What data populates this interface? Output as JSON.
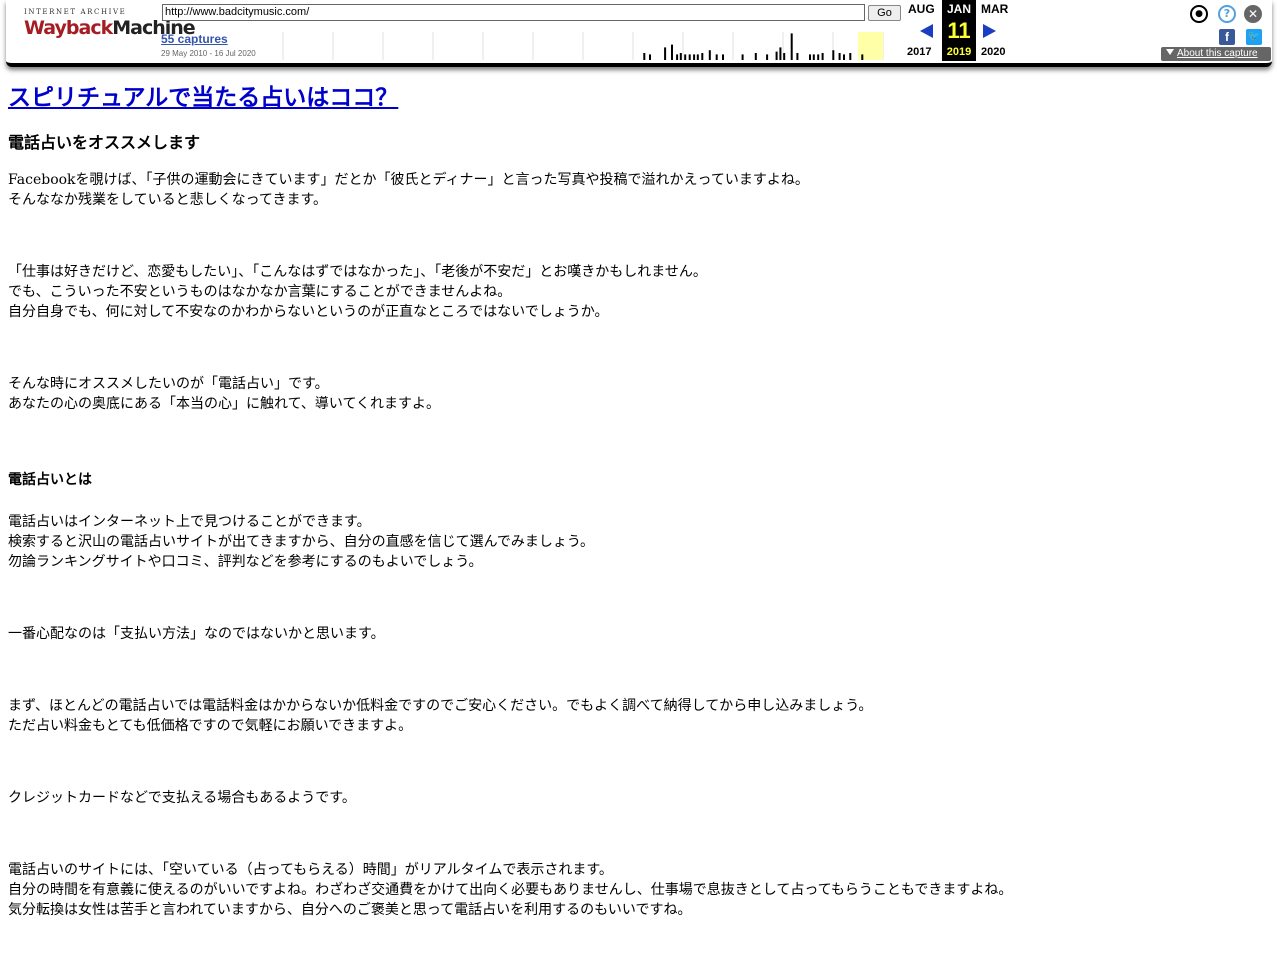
{
  "wayback": {
    "logo_top": "INTERNET ARCHIVE",
    "logo_main_a": "Wayback",
    "logo_main_b": "Machine",
    "url": "http://www.badcitymusic.com/",
    "go_label": "Go",
    "captures_label": "55 captures",
    "capture_range": "29 May 2010 - 16 Jul 2020",
    "prev_month": "AUG",
    "prev_year": "2017",
    "current_month": "JAN",
    "current_day": "11",
    "current_year": "2019",
    "next_month": "MAR",
    "next_year": "2020",
    "about_label": "About this capture",
    "sparkline_bars": [
      {
        "x": 0.583,
        "h": 0.25
      },
      {
        "x": 0.592,
        "h": 0.2
      },
      {
        "x": 0.616,
        "h": 0.45
      },
      {
        "x": 0.627,
        "h": 0.55
      },
      {
        "x": 0.635,
        "h": 0.2
      },
      {
        "x": 0.641,
        "h": 0.25
      },
      {
        "x": 0.648,
        "h": 0.2
      },
      {
        "x": 0.655,
        "h": 0.2
      },
      {
        "x": 0.662,
        "h": 0.2
      },
      {
        "x": 0.668,
        "h": 0.2
      },
      {
        "x": 0.675,
        "h": 0.25
      },
      {
        "x": 0.687,
        "h": 0.35
      },
      {
        "x": 0.698,
        "h": 0.2
      },
      {
        "x": 0.708,
        "h": 0.2
      },
      {
        "x": 0.739,
        "h": 0.2
      },
      {
        "x": 0.76,
        "h": 0.25
      },
      {
        "x": 0.778,
        "h": 0.2
      },
      {
        "x": 0.793,
        "h": 0.3
      },
      {
        "x": 0.799,
        "h": 0.45
      },
      {
        "x": 0.805,
        "h": 0.25
      },
      {
        "x": 0.817,
        "h": 0.95
      },
      {
        "x": 0.826,
        "h": 0.25
      },
      {
        "x": 0.846,
        "h": 0.2
      },
      {
        "x": 0.852,
        "h": 0.2
      },
      {
        "x": 0.859,
        "h": 0.2
      },
      {
        "x": 0.866,
        "h": 0.25
      },
      {
        "x": 0.883,
        "h": 0.35
      },
      {
        "x": 0.893,
        "h": 0.25
      },
      {
        "x": 0.9,
        "h": 0.2
      },
      {
        "x": 0.91,
        "h": 0.25
      },
      {
        "x": 0.929,
        "h": 0.2
      }
    ]
  },
  "page": {
    "title": "スピリチュアルで当たる占いはココ？",
    "subtitle": "電話占いをオススメします",
    "p1": [
      "Facebookを覗けば、「子供の運動会にきています」だとか「彼氏とディナー」と言った写真や投稿で溢れかえっていますよね。",
      "そんななか残業をしていると悲しくなってきます。"
    ],
    "p2": [
      "「仕事は好きだけど、恋愛もしたい」、「こんなはずではなかった」、「老後が不安だ」とお嘆きかもしれません。",
      "でも、こういった不安というものはなかなか言葉にすることができませんよね。",
      "自分自身でも、何に対して不安なのかわからないというのが正直なところではないでしょうか。"
    ],
    "p3": [
      "そんな時にオススメしたいのが「電話占い」です。",
      "あなたの心の奥底にある「本当の心」に触れて、導いてくれますよ。"
    ],
    "section_heading": "電話占いとは",
    "p4": [
      "電話占いはインターネット上で見つけることができます。",
      "検索すると沢山の電話占いサイトが出てきますから、自分の直感を信じて選んでみましょう。",
      "勿論ランキングサイトや口コミ、評判などを参考にするのもよいでしょう。"
    ],
    "p5": [
      "一番心配なのは「支払い方法」なのではないかと思います。"
    ],
    "p6": [
      "まず、ほとんどの電話占いでは電話料金はかからないか低料金ですのでご安心ください。でもよく調べて納得してから申し込みましょう。",
      "ただ占い料金もとても低価格ですので気軽にお願いできますよ。"
    ],
    "p7": [
      "クレジットカードなどで支払える場合もあるようです。"
    ],
    "p8": [
      "電話占いのサイトには、「空いている（占ってもらえる）時間」がリアルタイムで表示されます。",
      "自分の時間を有意義に使えるのがいいですよね。わざわざ交通費をかけて出向く必要もありませんし、仕事場で息抜きとして占ってもらうこともできますよね。",
      "気分転換は女性は苦手と言われていますから、自分へのご褒美と思って電話占いを利用するのもいいですね。"
    ]
  },
  "icons": {
    "user": "user-icon",
    "help": "help-icon",
    "close": "close-icon",
    "facebook": "facebook-icon",
    "twitter": "twitter-icon"
  },
  "colors": {
    "link": "#0000cc",
    "nav_arrow": "#1a3dc1",
    "current_day": "#ffff33",
    "facebook": "#3b5998",
    "twitter": "#1da1f2"
  }
}
